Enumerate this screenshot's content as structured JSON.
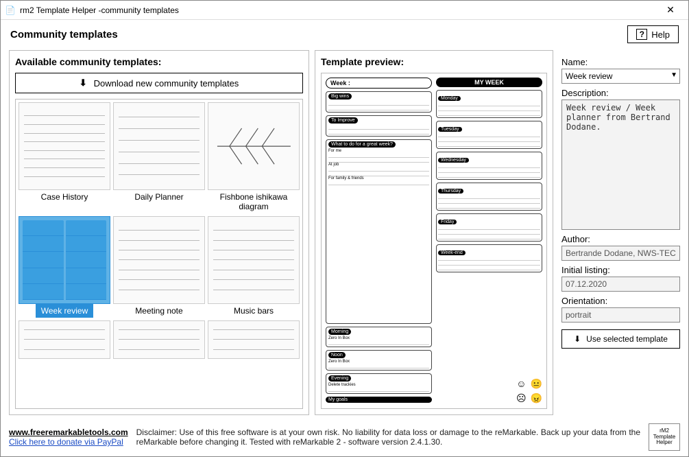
{
  "window": {
    "title": "rm2 Template Helper -community templates"
  },
  "header": {
    "title": "Community templates",
    "help_label": "Help"
  },
  "left": {
    "title": "Available community templates:",
    "download_label": "Download new community templates",
    "templates": [
      {
        "label": "Case History"
      },
      {
        "label": "Daily Planner"
      },
      {
        "label": "Fishbone ishikawa diagram"
      },
      {
        "label": "Week review"
      },
      {
        "label": "Meeting note"
      },
      {
        "label": "Music bars"
      }
    ]
  },
  "center": {
    "title": "Template preview:"
  },
  "preview": {
    "week_label": "Week :",
    "title": "MY WEEK",
    "left_sections": [
      "Big wins",
      "To Improve",
      "What to do for a great week?",
      "Morning",
      "Noon",
      "Evening",
      "My goals"
    ],
    "left_sub": [
      "For me",
      "At job",
      "For family & friends",
      "Zero In Box",
      "Zero In Box",
      "Delete trackies"
    ],
    "days": [
      "Monday",
      "Tuesday",
      "Wednesday",
      "Thursday",
      "Friday",
      "Week-end"
    ]
  },
  "right": {
    "name_label": "Name:",
    "name_value": "Week review",
    "desc_label": "Description:",
    "desc_value": "Week review / Week planner from Bertrand Dodane.",
    "author_label": "Author:",
    "author_value": "Bertrande Dodane, NWS-TECH",
    "listing_label": "Initial listing:",
    "listing_value": "07.12.2020",
    "orientation_label": "Orientation:",
    "orientation_value": "portrait",
    "use_label": "Use selected template"
  },
  "footer": {
    "site": "www.freeremarkabletools.com",
    "donate": "Click here to donate via PayPal",
    "disclaimer": "Disclaimer: Use of this free software is at your own risk. No liability for data loss or damage to the reMarkable. Back up your data from the reMarkable before changing it. Tested with reMarkable 2 - software version 2.4.1.30.",
    "logo_l1": "rM2",
    "logo_l2": "Template",
    "logo_l3": "Helper"
  }
}
